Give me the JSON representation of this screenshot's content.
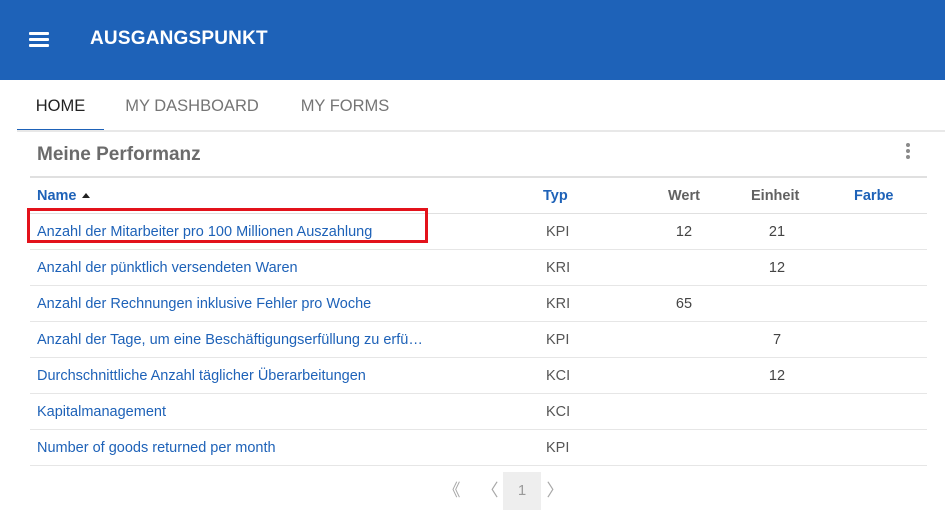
{
  "app": {
    "title": "AUSGANGSPUNKT",
    "menu_icon": "hamburger-menu-icon"
  },
  "tabs": [
    {
      "label": "HOME",
      "active": true
    },
    {
      "label": "MY DASHBOARD",
      "active": false
    },
    {
      "label": "MY FORMS",
      "active": false
    }
  ],
  "panel": {
    "title": "Meine Performanz",
    "more_icon": "vertical-dots-icon"
  },
  "table": {
    "columns": {
      "name": "Name",
      "typ": "Typ",
      "wert": "Wert",
      "einheit": "Einheit",
      "farbe": "Farbe"
    },
    "sort": {
      "column": "name",
      "direction": "ascending",
      "icon": "sort-ascending-icon"
    },
    "rows": [
      {
        "name": "Anzahl der Mitarbeiter pro 100 Millionen Auszahlung",
        "typ": "KPI",
        "wert": "12",
        "einheit": "21",
        "farbe": ""
      },
      {
        "name": "Anzahl der pünktlich versendeten Waren",
        "typ": "KRI",
        "wert": "",
        "einheit": "12",
        "farbe": ""
      },
      {
        "name": "Anzahl der Rechnungen inklusive Fehler pro Woche",
        "typ": "KRI",
        "wert": "65",
        "einheit": "",
        "farbe": ""
      },
      {
        "name": "Anzahl der Tage, um eine Beschäftigungserfüllung zu erfü…",
        "typ": "KPI",
        "wert": "",
        "einheit": "7",
        "farbe": ""
      },
      {
        "name": "Durchschnittliche Anzahl täglicher Überarbeitungen",
        "typ": "KCI",
        "wert": "",
        "einheit": "12",
        "farbe": ""
      },
      {
        "name": "Kapitalmanagement",
        "typ": "KCI",
        "wert": "",
        "einheit": "",
        "farbe": ""
      },
      {
        "name": "Number of goods returned per month",
        "typ": "KPI",
        "wert": "",
        "einheit": "",
        "farbe": ""
      }
    ]
  },
  "pager": {
    "first": "《",
    "prev": "〈",
    "current": "1",
    "next": "〉"
  },
  "colors": {
    "appbar": "#1e62b8",
    "link": "#1e62b8",
    "highlight": "#e3121b"
  }
}
